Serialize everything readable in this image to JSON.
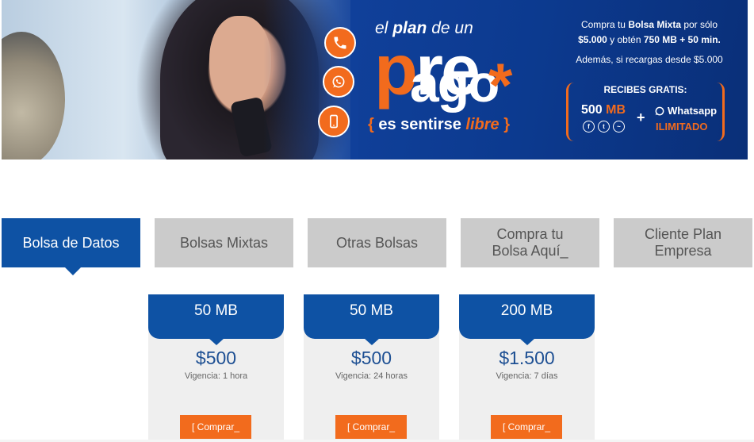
{
  "banner": {
    "tagline_pre": "el ",
    "tagline_bold": "plan",
    "tagline_post": " de un",
    "brand_p": "p",
    "brand_re": "re",
    "brand_ago": "ago",
    "brand_star": "*",
    "slogan_open": "{",
    "slogan_text": " es sentirse ",
    "slogan_libre": "libre",
    "slogan_close": " }",
    "promo_line1_pre": "Compra tu ",
    "promo_line1_bold": "Bolsa Mixta",
    "promo_line1_post": " por sólo",
    "promo_line2_a": "$5.000",
    "promo_line2_b": " y obtén ",
    "promo_line2_c": "750 MB + 50 min.",
    "promo_line3": "Además, si recargas desde $5.000",
    "recibes_title": "RECIBES GRATIS:",
    "mb_number": "500",
    "mb_unit": " MB",
    "plus": "+",
    "whatsapp": "Whatsapp",
    "ilimitado": "ILIMITADO",
    "icons": [
      "phone-icon",
      "whatsapp-icon",
      "mobile-icon",
      "facebook-icon",
      "twitter-icon",
      "browser-icon"
    ]
  },
  "tabs": [
    {
      "label": "Bolsa de Datos",
      "active": true
    },
    {
      "label": "Bolsas Mixtas",
      "active": false
    },
    {
      "label": "Otras Bolsas",
      "active": false
    },
    {
      "label": "Compra tu Bolsa Aquí_",
      "active": false
    },
    {
      "label": "Cliente Plan Empresa",
      "active": false
    }
  ],
  "cards": [
    {
      "size": "50 MB",
      "price": "$500",
      "validity": "Vigencia: 1 hora",
      "button": "[ Comprar_"
    },
    {
      "size": "50 MB",
      "price": "$500",
      "validity": "Vigencia: 24 horas",
      "button": "[ Comprar_"
    },
    {
      "size": "200 MB",
      "price": "$1.500",
      "validity": "Vigencia: 7 días",
      "button": "[ Comprar_"
    }
  ],
  "colors": {
    "brand_blue": "#0e52a4",
    "brand_orange": "#f26b1d",
    "tab_inactive": "#cbcbcb",
    "card_bg": "#efefef"
  }
}
